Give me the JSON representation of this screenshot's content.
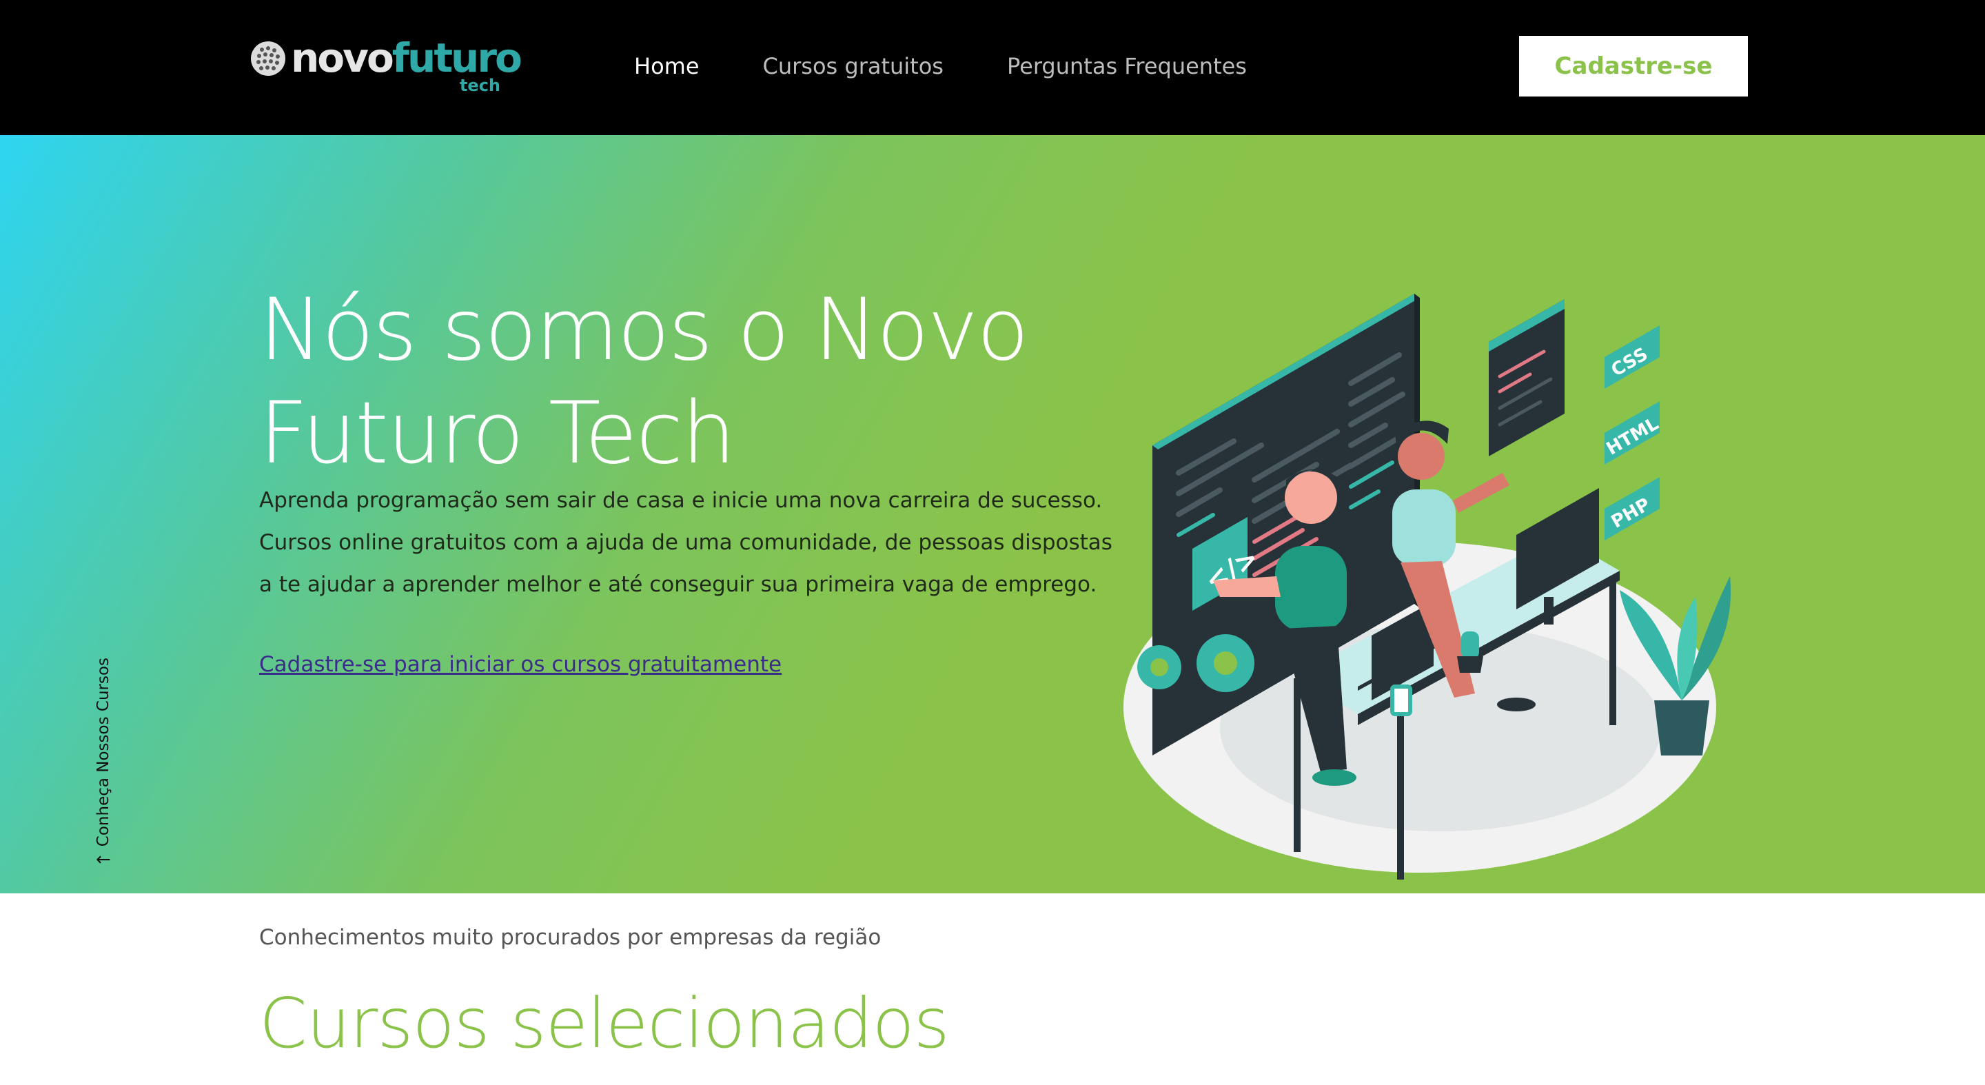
{
  "brand": {
    "name_part1": "novo",
    "name_part2": "futuro",
    "tagline": "tech"
  },
  "nav": {
    "items": [
      {
        "label": "Home",
        "active": true
      },
      {
        "label": "Cursos gratuitos",
        "active": false
      },
      {
        "label": "Perguntas Frequentes",
        "active": false
      }
    ],
    "cta_label": "Cadastre-se"
  },
  "hero": {
    "title": "Nós somos o Novo Futuro Tech",
    "description": "Aprenda programação sem sair de casa e inicie uma nova carreira de sucesso. Cursos online gratuitos com a ajuda de uma comunidade, de pessoas dispostas a te ajudar a aprender melhor e até conseguir sua primeira vaga de emprego.",
    "cta_link": "Cadastre-se para iniciar os cursos gratuitamente",
    "scroll_hint": "Conheça Nossos Cursos",
    "illustration_badges": [
      "CSS",
      "HTML",
      "PHP"
    ]
  },
  "courses": {
    "kicker": "Conhecimentos muito procurados por empresas da região",
    "title": "Cursos selecionados"
  },
  "colors": {
    "brand_green": "#8bc34a",
    "brand_teal": "#2fa8a8",
    "gradient_start": "#2ed5f1",
    "navbar_bg": "#000000"
  }
}
